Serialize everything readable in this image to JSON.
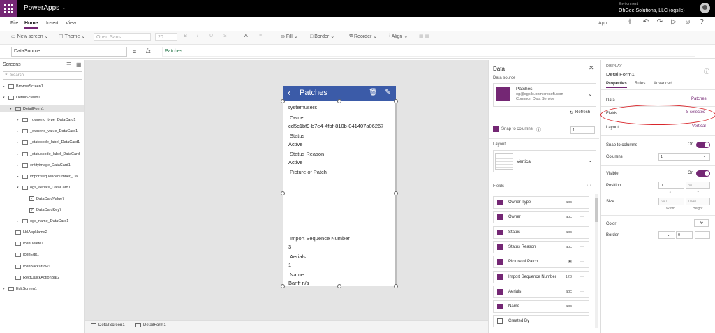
{
  "app": {
    "name": "PowerApps",
    "env_label": "Environment",
    "env_value": "OhGee Solutions, LLC (ogsllc)"
  },
  "menu": {
    "items": [
      "File",
      "Home",
      "Insert",
      "View"
    ],
    "active": "Home",
    "app_label": "App"
  },
  "ribbon": {
    "new_screen": "New screen",
    "theme": "Theme",
    "font": "Open Sans",
    "font_size": "20",
    "bold": "B",
    "fill": "Fill",
    "border": "Border",
    "reorder": "Reorder",
    "align": "Align"
  },
  "formula": {
    "property": "DataSource",
    "eq": "=",
    "fx": "fx",
    "value": "Patches"
  },
  "tree": {
    "header": "Screens",
    "search_placeholder": "Search",
    "items": [
      {
        "label": "BrowseScreen1",
        "level": 0,
        "twisty": "▸",
        "type": "screen"
      },
      {
        "label": "DetailScreen1",
        "level": 0,
        "twisty": "▾",
        "type": "screen"
      },
      {
        "label": "DetailForm1",
        "level": 1,
        "twisty": "▾",
        "type": "form",
        "selected": true
      },
      {
        "label": "_ownerid_type_DataCard1",
        "level": 2,
        "twisty": "▸",
        "type": "card"
      },
      {
        "label": "_ownerid_value_DataCard1",
        "level": 2,
        "twisty": "▸",
        "type": "card"
      },
      {
        "label": "_statecode_label_DataCard1",
        "level": 2,
        "twisty": "▸",
        "type": "card"
      },
      {
        "label": "_statuscode_label_DataCard",
        "level": 2,
        "twisty": "▸",
        "type": "card"
      },
      {
        "label": "entityimage_DataCard1",
        "level": 2,
        "twisty": "▸",
        "type": "card"
      },
      {
        "label": "importsequencenumber_Da",
        "level": 2,
        "twisty": "▸",
        "type": "card"
      },
      {
        "label": "ogs_aerials_DataCard1",
        "level": 2,
        "twisty": "▾",
        "type": "card"
      },
      {
        "label": "DataCardValue7",
        "level": 3,
        "twisty": "",
        "type": "check"
      },
      {
        "label": "DataCardKey7",
        "level": 3,
        "twisty": "",
        "type": "check"
      },
      {
        "label": "ogs_name_DataCard1",
        "level": 2,
        "twisty": "▸",
        "type": "card"
      },
      {
        "label": "LblAppName2",
        "level": 1,
        "twisty": "",
        "type": "label"
      },
      {
        "label": "IconDelete1",
        "level": 1,
        "twisty": "",
        "type": "icon"
      },
      {
        "label": "IconEdit1",
        "level": 1,
        "twisty": "",
        "type": "icon"
      },
      {
        "label": "IconBackarrow1",
        "level": 1,
        "twisty": "",
        "type": "icon"
      },
      {
        "label": "RectQuickActionBar2",
        "level": 1,
        "twisty": "",
        "type": "rect"
      },
      {
        "label": "EditScreen1",
        "level": 0,
        "twisty": "▸",
        "type": "screen"
      }
    ]
  },
  "phone": {
    "title": "Patches",
    "entity": "systemusers",
    "fields": [
      {
        "label": "Owner",
        "value": "cd5c1bf9-b7e4-4fbf-810b-041407a06267"
      },
      {
        "label": "Status",
        "value": "Active"
      },
      {
        "label": "Status Reason",
        "value": "Active"
      },
      {
        "label": "Picture of Patch",
        "value": ""
      },
      {
        "label": "Import Sequence Number",
        "value": "3"
      },
      {
        "label": "Aerials",
        "value": "1"
      },
      {
        "label": "Name",
        "value": "Banff   n/s"
      }
    ]
  },
  "bottom_tabs": [
    "DetailScreen1",
    "DetailForm1"
  ],
  "data_pane": {
    "title": "Data",
    "ds_header": "Data source",
    "ds_name": "Patches",
    "ds_email": "og@ogsllc.onmicrosoft.com",
    "ds_type": "Common Data Service",
    "refresh": "Refresh",
    "snap_label": "Snap to columns",
    "snap_value": "1",
    "layout_header": "Layout",
    "layout_value": "Vertical",
    "fields_header": "Fields",
    "fields": [
      {
        "name": "Owner Type",
        "type": "abc",
        "checked": true
      },
      {
        "name": "Owner",
        "type": "abc",
        "checked": true
      },
      {
        "name": "Status",
        "type": "abc",
        "checked": true
      },
      {
        "name": "Status Reason",
        "type": "abc",
        "checked": true
      },
      {
        "name": "Picture of Patch",
        "type": "▣",
        "checked": true
      },
      {
        "name": "Import Sequence Number",
        "type": "123",
        "checked": true
      },
      {
        "name": "Aerials",
        "type": "abc",
        "checked": true
      },
      {
        "name": "Name",
        "type": "abc",
        "checked": true
      },
      {
        "name": "Created By",
        "type": "",
        "checked": false
      }
    ]
  },
  "props": {
    "kind": "DISPLAY",
    "name": "DetailForm1",
    "tabs": [
      "Properties",
      "Rules",
      "Advanced"
    ],
    "data_label": "Data",
    "data_value": "Patches",
    "fields_label": "Fields",
    "fields_value": "8 selected",
    "layout_label": "Layout",
    "layout_value": "Vertical",
    "snap_label": "Snap to columns",
    "on": "On",
    "columns_label": "Columns",
    "columns_value": "1",
    "visible_label": "Visible",
    "position_label": "Position",
    "pos_x": "0",
    "pos_y": "88",
    "x_lbl": "X",
    "y_lbl": "Y",
    "size_label": "Size",
    "width": "640",
    "height": "1048",
    "width_lbl": "Width",
    "height_lbl": "Height",
    "color_label": "Color",
    "border_label": "Border",
    "border_value": "0"
  },
  "colors": {
    "brand": "#742774",
    "header_blue": "#3b5ba8",
    "annotation_red": "#d9262b"
  }
}
